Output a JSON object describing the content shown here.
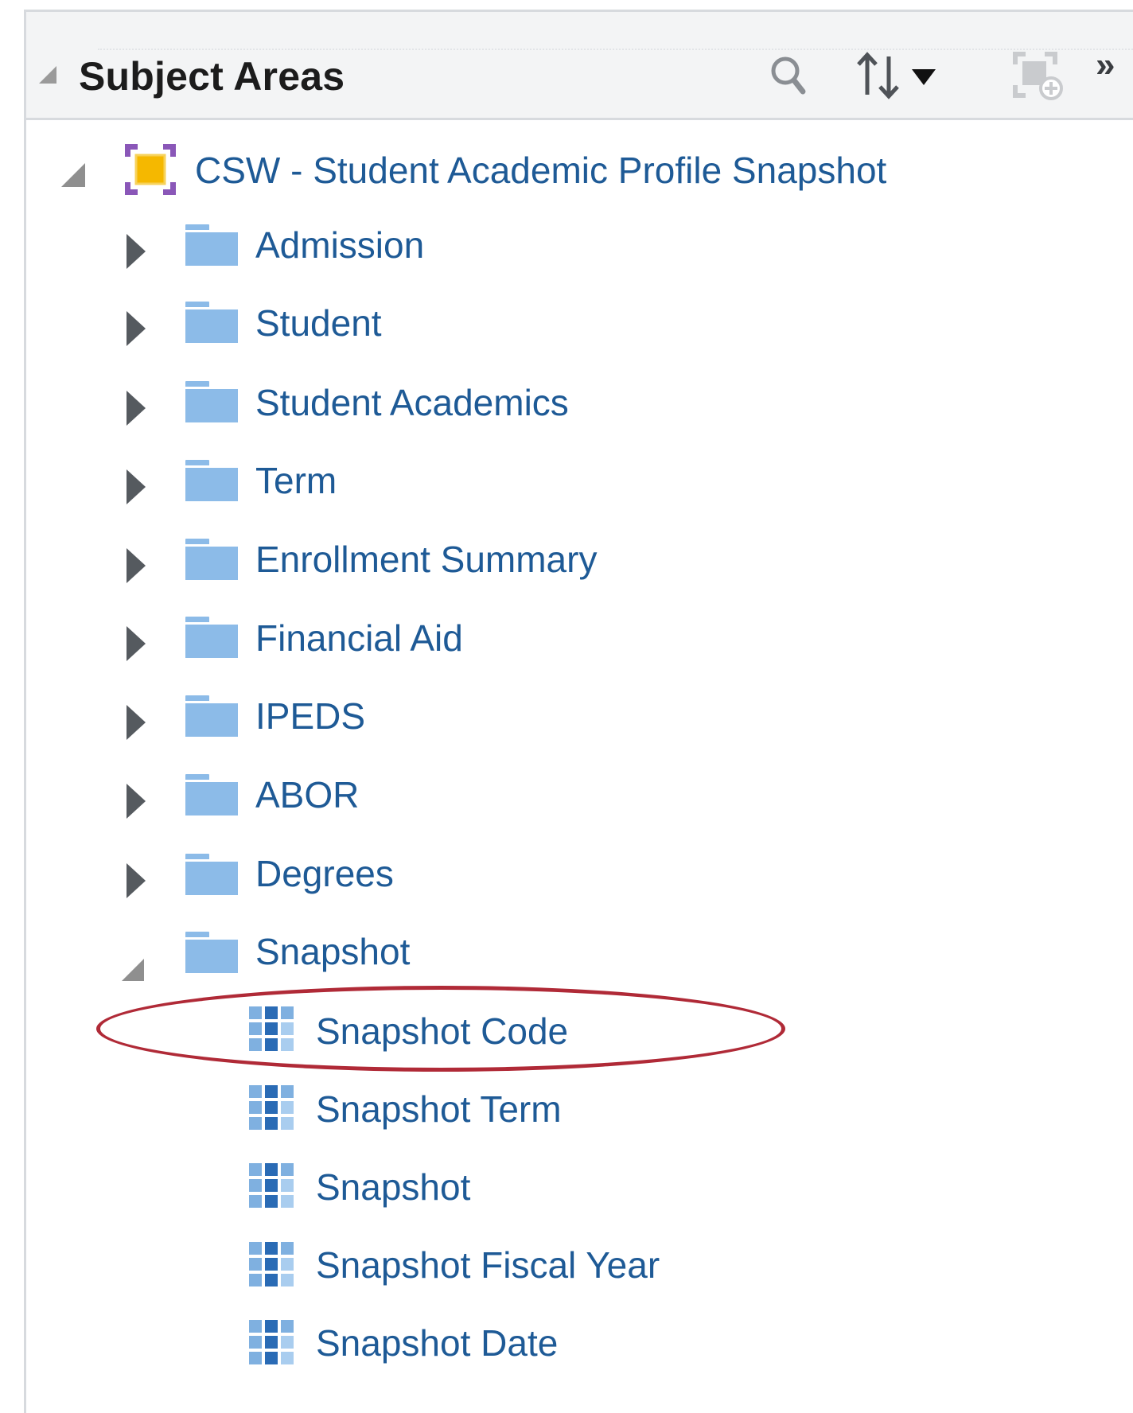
{
  "panel": {
    "title": "Subject Areas"
  },
  "toolbar": {
    "icons": [
      "search-icon",
      "sort-icon",
      "dropdown-arrow-icon",
      "add-subject-area-icon",
      "more-chevron-icon"
    ],
    "more_label": "»"
  },
  "tree": {
    "root": {
      "label": "CSW - Student Academic Profile Snapshot",
      "expanded": true
    },
    "folders": [
      {
        "label": "Admission",
        "expanded": false
      },
      {
        "label": "Student",
        "expanded": false
      },
      {
        "label": "Student Academics",
        "expanded": false
      },
      {
        "label": "Term",
        "expanded": false
      },
      {
        "label": "Enrollment Summary",
        "expanded": false
      },
      {
        "label": "Financial Aid",
        "expanded": false
      },
      {
        "label": "IPEDS",
        "expanded": false
      },
      {
        "label": "ABOR",
        "expanded": false
      },
      {
        "label": "Degrees",
        "expanded": false
      },
      {
        "label": "Snapshot",
        "expanded": true
      }
    ],
    "snapshot_columns": [
      {
        "label": "Snapshot Code",
        "highlighted": true
      },
      {
        "label": "Snapshot Term",
        "highlighted": false
      },
      {
        "label": "Snapshot",
        "highlighted": false
      },
      {
        "label": "Snapshot Fiscal Year",
        "highlighted": false
      },
      {
        "label": "Snapshot Date",
        "highlighted": false
      }
    ]
  },
  "colors": {
    "link_text": "#1e5a96",
    "folder": "#8cbbe8",
    "highlight_ellipse": "#b02a37",
    "header_bg": "#f3f4f5"
  }
}
